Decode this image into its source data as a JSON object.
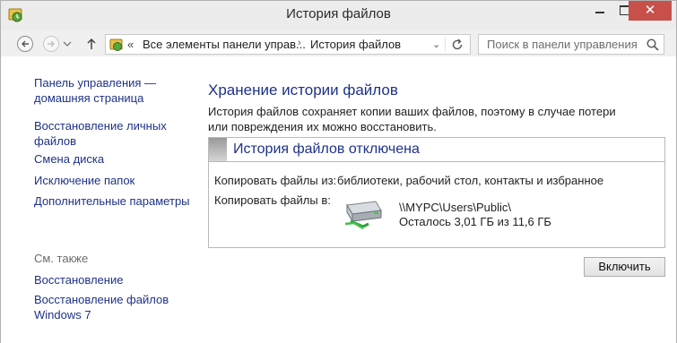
{
  "window": {
    "title": "История файлов",
    "controls": {
      "minimize": "minimize-icon",
      "maximize": "maximize-icon",
      "close": "✕"
    },
    "colors": {
      "close": "#c7504b",
      "link": "#1e3287"
    }
  },
  "nav": {
    "back_icon": "back-arrow-icon",
    "forward_icon": "forward-arrow-icon",
    "up_icon": "up-arrow-icon",
    "address": {
      "overflow": "«",
      "crumbs": [
        "Все элементы панели управ...",
        "История файлов"
      ],
      "separator": "›",
      "dropdown": "⌄"
    },
    "search": {
      "placeholder": "Поиск в панели управления"
    }
  },
  "sidebar": {
    "links": [
      "Панель управления —\nдомашняя страница",
      "Восстановление личных\nфайлов",
      "Смена диска",
      "Исключение папок",
      "Дополнительные параметры"
    ],
    "see_also_title": "См. также",
    "see_also": [
      "Восстановление",
      "Восстановление файлов\nWindows 7"
    ]
  },
  "main": {
    "title": "Хранение истории файлов",
    "description": "История файлов сохраняет копии ваших файлов, поэтому в случае потери или повреждения их можно восстановить.",
    "status_title": "История файлов отключена",
    "copy_from_label": "Копировать файлы из:",
    "copy_from_value": "библиотеки, рабочий стол, контакты и избранное",
    "copy_to_label": "Копировать файлы в:",
    "drive_path": "\\\\MYPC\\Users\\Public\\",
    "drive_space": "Осталось 3,01 ГБ из 11,6 ГБ",
    "enable_button": "Включить"
  }
}
